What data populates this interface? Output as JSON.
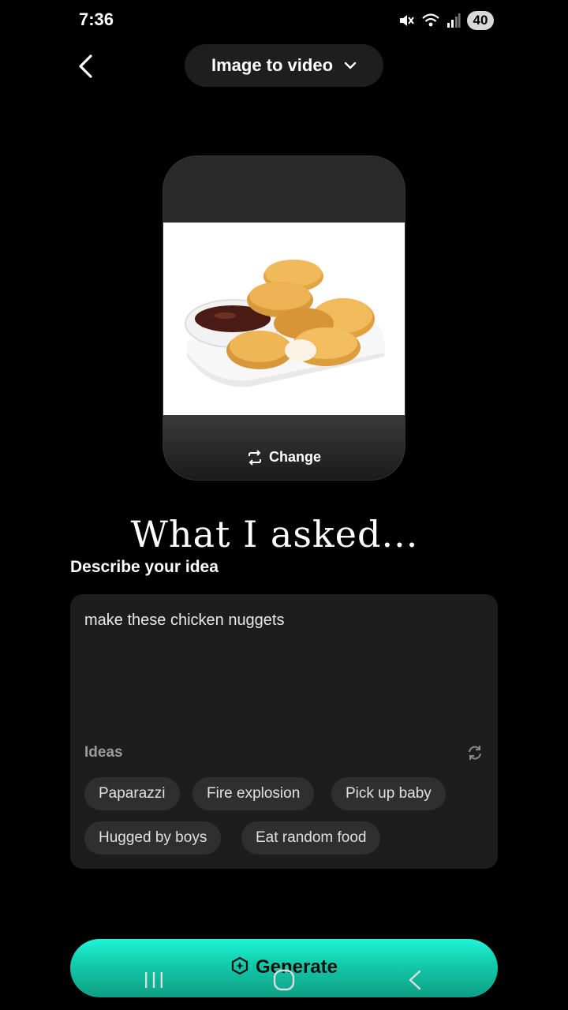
{
  "status_bar": {
    "time": "7:36",
    "battery": "40",
    "icons": [
      "mute-icon",
      "wifi-icon",
      "signal-icon"
    ]
  },
  "header": {
    "mode_label": "Image to video",
    "back_icon": "chevron-left-icon",
    "dropdown_icon": "chevron-down-icon"
  },
  "image_card": {
    "change_label": "Change"
  },
  "caption": "What I asked...",
  "prompt": {
    "section_label": "Describe your idea",
    "value": "make these chicken nuggets",
    "ideas_label": "Ideas",
    "ideas": [
      "Paparazzi",
      "Fire explosion",
      "Pick up baby",
      "Hugged by boys",
      "Eat random food"
    ]
  },
  "generate": {
    "label": "Generate",
    "colors": {
      "top": "#1ff5d8",
      "bottom": "#0e9e86"
    }
  },
  "nav_bar": {
    "icons": [
      "recent-apps-icon",
      "home-icon",
      "back-nav-icon"
    ]
  }
}
